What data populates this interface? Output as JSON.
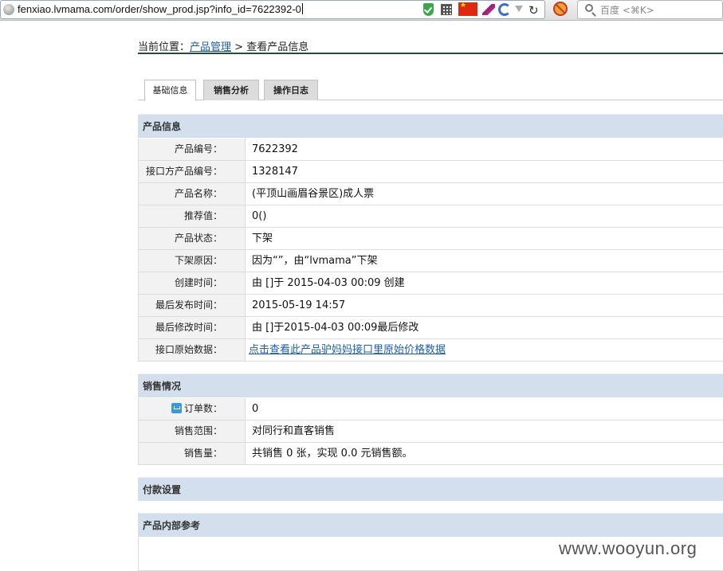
{
  "browser": {
    "url": "fenxiao.lvmama.com/order/show_prod.jsp?info_id=7622392-0",
    "search_placeholder": "百度 <⌘K>",
    "icons": [
      "globe-icon",
      "shield-icon",
      "qr-code-icon",
      "china-flag-icon",
      "feather-icon",
      "swirl-icon",
      "dropdown-icon",
      "reload-icon",
      "addon-blocked-icon",
      "search-icon"
    ]
  },
  "breadcrumb": {
    "prefix": "当前位置：",
    "link": "产品管理",
    "separator": " > ",
    "current": "查看产品信息"
  },
  "tabs": [
    "基础信息",
    "销售分析",
    "操作日志"
  ],
  "active_tab": "基础信息",
  "product_info": {
    "title": "产品信息",
    "rows": [
      {
        "label": "产品编号：",
        "value": "7622392"
      },
      {
        "label": "接口方产品编号：",
        "value": "1328147"
      },
      {
        "label": "产品名称：",
        "value": "(平顶山画眉谷景区)成人票"
      },
      {
        "label": "推荐值：",
        "value": "0()"
      },
      {
        "label": "产品状态：",
        "value": "下架"
      },
      {
        "label": "下架原因：",
        "value": "因为“”，由“lvmama”下架"
      },
      {
        "label": "创建时间：",
        "value": "由 []于 2015-04-03 00:09 创建"
      },
      {
        "label": "最后发布时间：",
        "value": "2015-05-19 14:57"
      },
      {
        "label": "最后修改时间：",
        "value": "由 []于2015-04-03 00:09最后修改"
      },
      {
        "label": "接口原始数据：",
        "value": "点击查看此产品驴妈妈接口里原始价格数据"
      }
    ]
  },
  "sales_info": {
    "title": "销售情况",
    "rows": [
      {
        "label": "订单数：",
        "value": "0"
      },
      {
        "label": "销售范围：",
        "value": "对同行和直客销售"
      },
      {
        "label": "销售量：",
        "value": "共销售 0 张，实现 0.0 元销售额。"
      }
    ]
  },
  "payment_settings": {
    "title": "付款设置"
  },
  "internal_reference": {
    "title": "产品内部参考"
  },
  "watermark": "www.wooyun.org",
  "colors": {
    "section_bg": "#d3dfec",
    "label_bg": "#f2f2f2",
    "link": "#1f5fa8",
    "divider": "#2c4a3c"
  }
}
